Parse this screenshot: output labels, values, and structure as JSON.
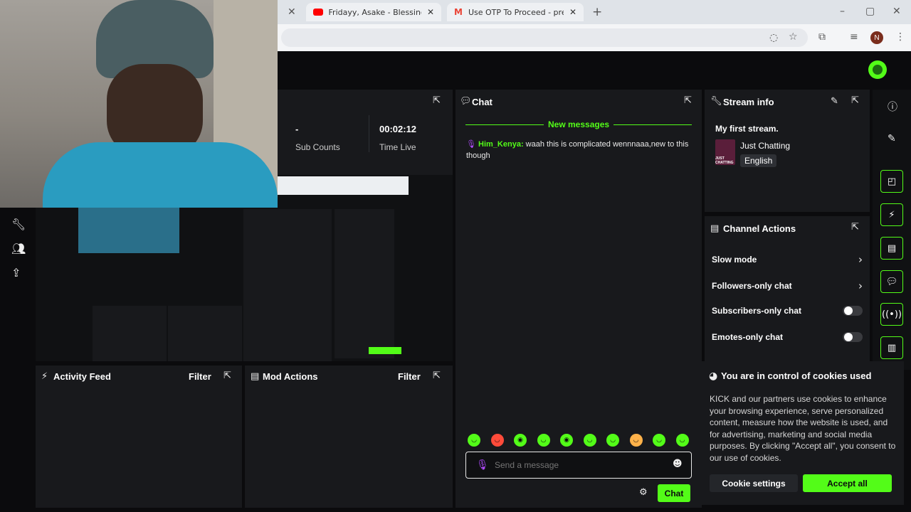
{
  "browser": {
    "tabs": [
      {
        "title": "Fridayy, Asake - Blessings (Rem",
        "icon": "youtube-icon",
        "color": "#ff0000"
      },
      {
        "title": "Use OTP To Proceed - prettype",
        "icon": "gmail-icon",
        "color": "#ea4335"
      }
    ],
    "new_tab": "+",
    "profile_initial": "N"
  },
  "stats": {
    "sub_value": "-",
    "sub_label": "Sub Counts",
    "time_value": "00:02:12",
    "time_label": "Time Live"
  },
  "chat": {
    "title": "Chat",
    "new_messages": "New messages",
    "messages": [
      {
        "user": "Him_Kenya:",
        "text": "waah this is complicated wennnaaa,new to this though"
      }
    ],
    "input_placeholder": "Send a message",
    "send_label": "Chat"
  },
  "stream_info": {
    "title": "Stream info",
    "stream_title": "My first stream.",
    "category": "Just Chatting",
    "category_thumb_text": "JUST CHATTING",
    "language": "English"
  },
  "channel_actions": {
    "title": "Channel Actions",
    "items": [
      {
        "label": "Slow mode",
        "kind": "chevron"
      },
      {
        "label": "Followers-only chat",
        "kind": "chevron"
      },
      {
        "label": "Subscribers-only chat",
        "kind": "toggle"
      },
      {
        "label": "Emotes-only chat",
        "kind": "toggle"
      }
    ]
  },
  "activity_feed": {
    "title": "Activity Feed",
    "filter": "Filter"
  },
  "mod_actions": {
    "title": "Mod Actions",
    "filter": "Filter"
  },
  "cookie": {
    "title": "You are in control of cookies used",
    "body": "KICK and our partners use cookies to enhance your browsing experience, serve personalized content, measure how the website is used, and for advertising, marketing and social media purposes. By clicking \"Accept all\", you consent to our use of cookies.",
    "settings_label": "Cookie settings",
    "accept_label": "Accept all"
  },
  "colors": {
    "accent": "#53fc18",
    "mic": "#b14cff",
    "panel": "#18191c"
  }
}
